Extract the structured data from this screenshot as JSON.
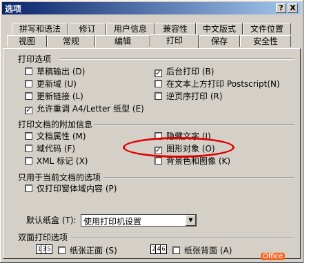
{
  "window": {
    "title": "选项",
    "help_btn": "?",
    "close_btn": "X"
  },
  "tabs_row1": [
    {
      "label": "拼写和语法"
    },
    {
      "label": "修订"
    },
    {
      "label": "用户信息"
    },
    {
      "label": "兼容性"
    },
    {
      "label": "中文版式"
    },
    {
      "label": "文件位置"
    }
  ],
  "tabs_row2": [
    {
      "label": "视图"
    },
    {
      "label": "常规"
    },
    {
      "label": "编辑"
    },
    {
      "label": "打印",
      "active": true
    },
    {
      "label": "保存"
    },
    {
      "label": "安全性"
    }
  ],
  "print_options": {
    "title": "打印选项",
    "items": [
      {
        "label": "草稿输出 (D)",
        "checked": false
      },
      {
        "label": "更新域 (U)",
        "checked": false
      },
      {
        "label": "更新链接 (L)",
        "checked": false
      },
      {
        "label": "允许重调 A4/Letter 纸型 (E)",
        "checked": true
      },
      {
        "label": "后台打印 (B)",
        "checked": true
      },
      {
        "label": "在文本上方打印 Postscript(N)",
        "checked": false
      },
      {
        "label": "逆页序打印 (R)",
        "checked": false
      }
    ]
  },
  "include_with_document": {
    "title": "打印文档的附加信息",
    "items": [
      {
        "label": "文档属性 (M)",
        "checked": false
      },
      {
        "label": "域代码 (F)",
        "checked": false
      },
      {
        "label": "XML 标记 (X)",
        "checked": false
      },
      {
        "label": "隐藏文字 (I)",
        "checked": false
      },
      {
        "label": "图形对象 (O)",
        "checked": true
      },
      {
        "label": "背景色和图像 (K)",
        "checked": false
      }
    ]
  },
  "current_doc_only": {
    "title": "只用于当前文档的选项",
    "items": [
      {
        "label": "仅打印窗体域内容 (P)",
        "checked": false
      }
    ]
  },
  "default_tray": {
    "label": "默认纸盒 (T):",
    "value": "使用打印机设置"
  },
  "duplex": {
    "title": "双面打印选项",
    "front_label": "纸张正面 (S)",
    "back_label": "纸张背面 (A)",
    "front_icon_pages": [
      "1",
      "3",
      "5"
    ],
    "back_icon_pages": [
      "2",
      "4",
      "6"
    ]
  },
  "watermark": {
    "text": "Office"
  }
}
